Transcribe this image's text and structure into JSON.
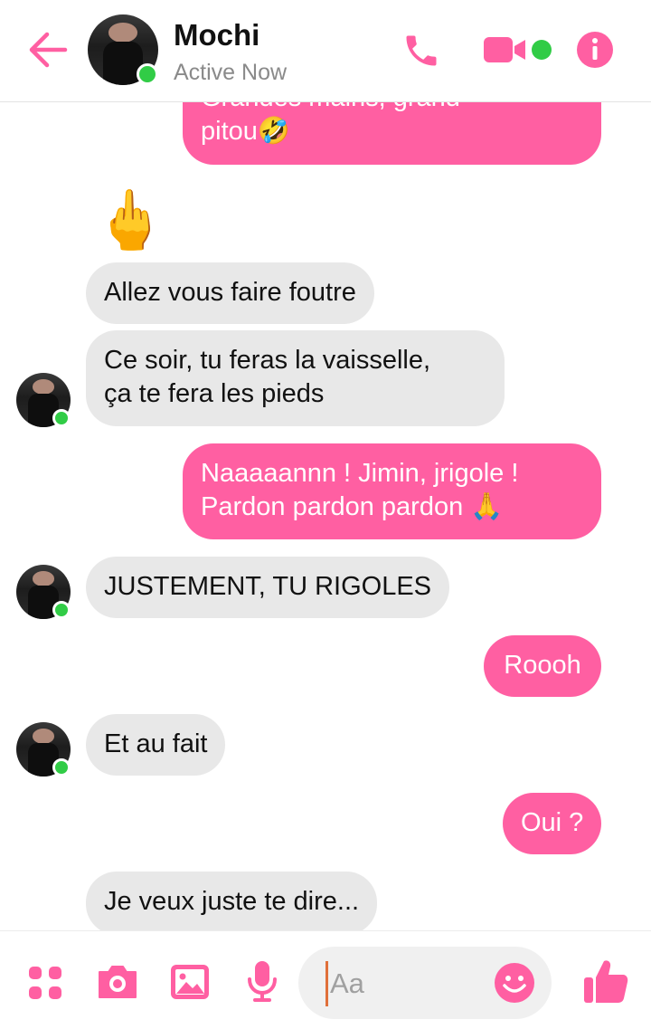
{
  "header": {
    "contact_name": "Mochi",
    "status": "Active Now",
    "icons": [
      "back-arrow-icon",
      "phone-icon",
      "video-camera-icon",
      "info-icon"
    ]
  },
  "messages": [
    {
      "side": "out",
      "text": "Grandes mains, grand"
    },
    {
      "side": "out",
      "text": "pitou🤣"
    },
    {
      "side": "in",
      "emoji": "🖕"
    },
    {
      "side": "in",
      "text": "Allez vous faire foutre"
    },
    {
      "side": "in",
      "lines": [
        "Ce soir, tu feras la vaisselle,",
        "ça te fera les pieds"
      ]
    },
    {
      "side": "out",
      "lines": [
        "Naaaaannn ! Jimin, jrigole !",
        "Pardon pardon pardon 🙏"
      ]
    },
    {
      "side": "in",
      "text": "JUSTEMENT, TU RIGOLES"
    },
    {
      "side": "out",
      "text": "Roooh"
    },
    {
      "side": "in",
      "text": "Et au fait"
    },
    {
      "side": "out",
      "text": "Oui ?"
    },
    {
      "side": "in",
      "text": "Je veux juste te dire..."
    }
  ],
  "composer": {
    "placeholder": "Aa",
    "icons": [
      "apps-grid-icon",
      "camera-icon",
      "gallery-icon",
      "microphone-icon",
      "emoji-icon",
      "thumbs-up-icon"
    ]
  },
  "colors": {
    "accent": "#ff5fa2",
    "incoming": "#e8e8e8",
    "online": "#31cc46"
  }
}
